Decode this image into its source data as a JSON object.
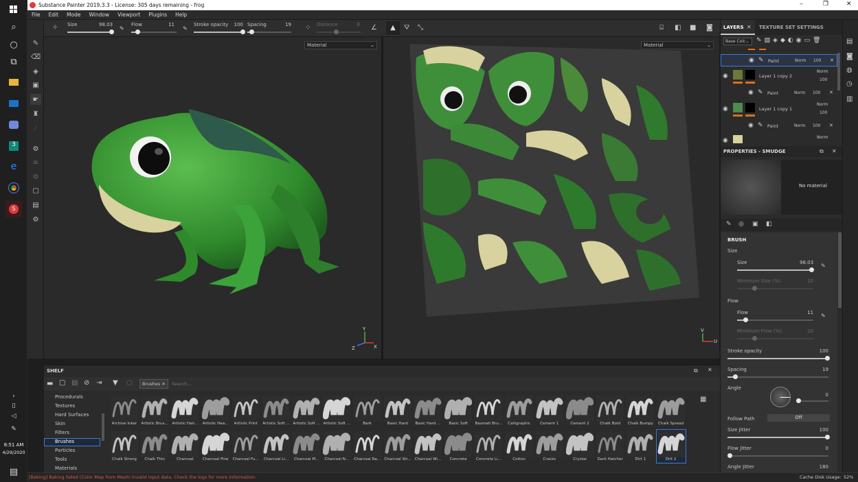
{
  "window": {
    "title": "Substance Painter 2019.3.3 - License: 305 days remaining - frog"
  },
  "menu": [
    "File",
    "Edit",
    "Mode",
    "Window",
    "Viewport",
    "Plugins",
    "Help"
  ],
  "toolbar": {
    "size_label": "Size",
    "size_value": "98.03",
    "flow_label": "Flow",
    "flow_value": "11",
    "stroke_label": "Stroke opacity",
    "stroke_value": "100",
    "spacing_label": "Spacing",
    "spacing_value": "19",
    "distance_label": "Distance",
    "distance_value": "8"
  },
  "viewport3d": {
    "mode": "Material",
    "axes": {
      "y": "Y",
      "x": "X",
      "z": "Z"
    }
  },
  "viewport2d": {
    "mode": "Material",
    "axes": {
      "v": "V",
      "u": "U"
    }
  },
  "layers_panel": {
    "tab_layers": "LAYERS",
    "tab_texture": "TEXTURE SET SETTINGS",
    "channel": "Base Colc",
    "rows": [
      {
        "type": "effect",
        "name": "Paint",
        "blend": "Norm",
        "opacity": "100"
      },
      {
        "type": "layer",
        "name": "Layer 1 copy 2",
        "blend": "Norm",
        "opacity": "100",
        "color": "#6b7a38"
      },
      {
        "type": "effect",
        "name": "Paint",
        "blend": "Norm",
        "opacity": "100"
      },
      {
        "type": "layer",
        "name": "Layer 1 copy 1",
        "blend": "Norm",
        "opacity": "100",
        "color": "#4f8a4f"
      },
      {
        "type": "effect",
        "name": "Paint",
        "blend": "Norm",
        "opacity": "100"
      }
    ],
    "last_blend": "Norm"
  },
  "properties": {
    "title": "PROPERTIES - SMUDGE",
    "no_material": "No material",
    "brush_header": "BRUSH",
    "size_section": "Size",
    "size_label": "Size",
    "size_value": "98.03",
    "min_size_label": "Minimum Size (%)",
    "min_size_value": "20",
    "flow_section": "Flow",
    "flow_label": "Flow",
    "flow_value": "11",
    "min_flow_label": "Minimum Flow (%)",
    "min_flow_value": "20",
    "stroke_label": "Stroke opacity",
    "stroke_value": "100",
    "spacing_label": "Spacing",
    "spacing_value": "19",
    "angle_label": "Angle",
    "angle_value": "0",
    "follow_label": "Follow Path",
    "follow_value": "Off",
    "size_jitter_label": "Size Jitter",
    "size_jitter_value": "100",
    "flow_jitter_label": "Flow Jitter",
    "flow_jitter_value": "0",
    "angle_jitter_label": "Angle Jitter",
    "angle_jitter_value": "180"
  },
  "shelf": {
    "title": "SHELF",
    "filter_tag": "Brushes",
    "search_placeholder": "Search...",
    "categories": [
      "Procedurals",
      "Textures",
      "Hard Surfaces",
      "Skin",
      "Filters",
      "Brushes",
      "Particles",
      "Tools",
      "Materials"
    ],
    "selected_category": "Brushes",
    "row1": [
      "Archive Inker",
      "Artistic Brus...",
      "Artistic Hair...",
      "Artistic Hea...",
      "Artistic Print",
      "Artistic Soft ...",
      "Artistic Soft ...",
      "Artistic Soft ...",
      "Bark",
      "Basic Hard",
      "Basic Hard ...",
      "Basic Soft",
      "Basmati Bru...",
      "Calligraphic",
      "Cement 1",
      "Cement 2",
      "Chalk Bold",
      "Chalk Bumpy",
      "Chalk Spread"
    ],
    "row2": [
      "Chalk Strong",
      "Chalk Thin",
      "Charcoal",
      "Charcoal Fine",
      "Charcoal Fu...",
      "Charcoal Li...",
      "Charcoal M...",
      "Charcoal N...",
      "Charcoal Ra...",
      "Charcoal Str...",
      "Charcoal Wi...",
      "Concrete",
      "Concrete Li...",
      "Cotton",
      "Cracks",
      "Crystal",
      "Dark Hatcher",
      "Dirt 1",
      "Dirt 2"
    ],
    "selected_brush": "Dirt 2"
  },
  "status": {
    "error": "[Baking] Baking failed (Color Map from Mesh) Invalid input data. Check the logs for more information.",
    "cache_label": "Cache Disk Usage:",
    "cache_value": "52%"
  },
  "clock": {
    "time": "8:51 AM",
    "date": "4/29/2020"
  },
  "colors": {
    "accent_orange": "#e0701c",
    "selection_blue": "#3d7bd6",
    "frog_green": "#3f9a3a",
    "error_red": "#e05a3a"
  }
}
